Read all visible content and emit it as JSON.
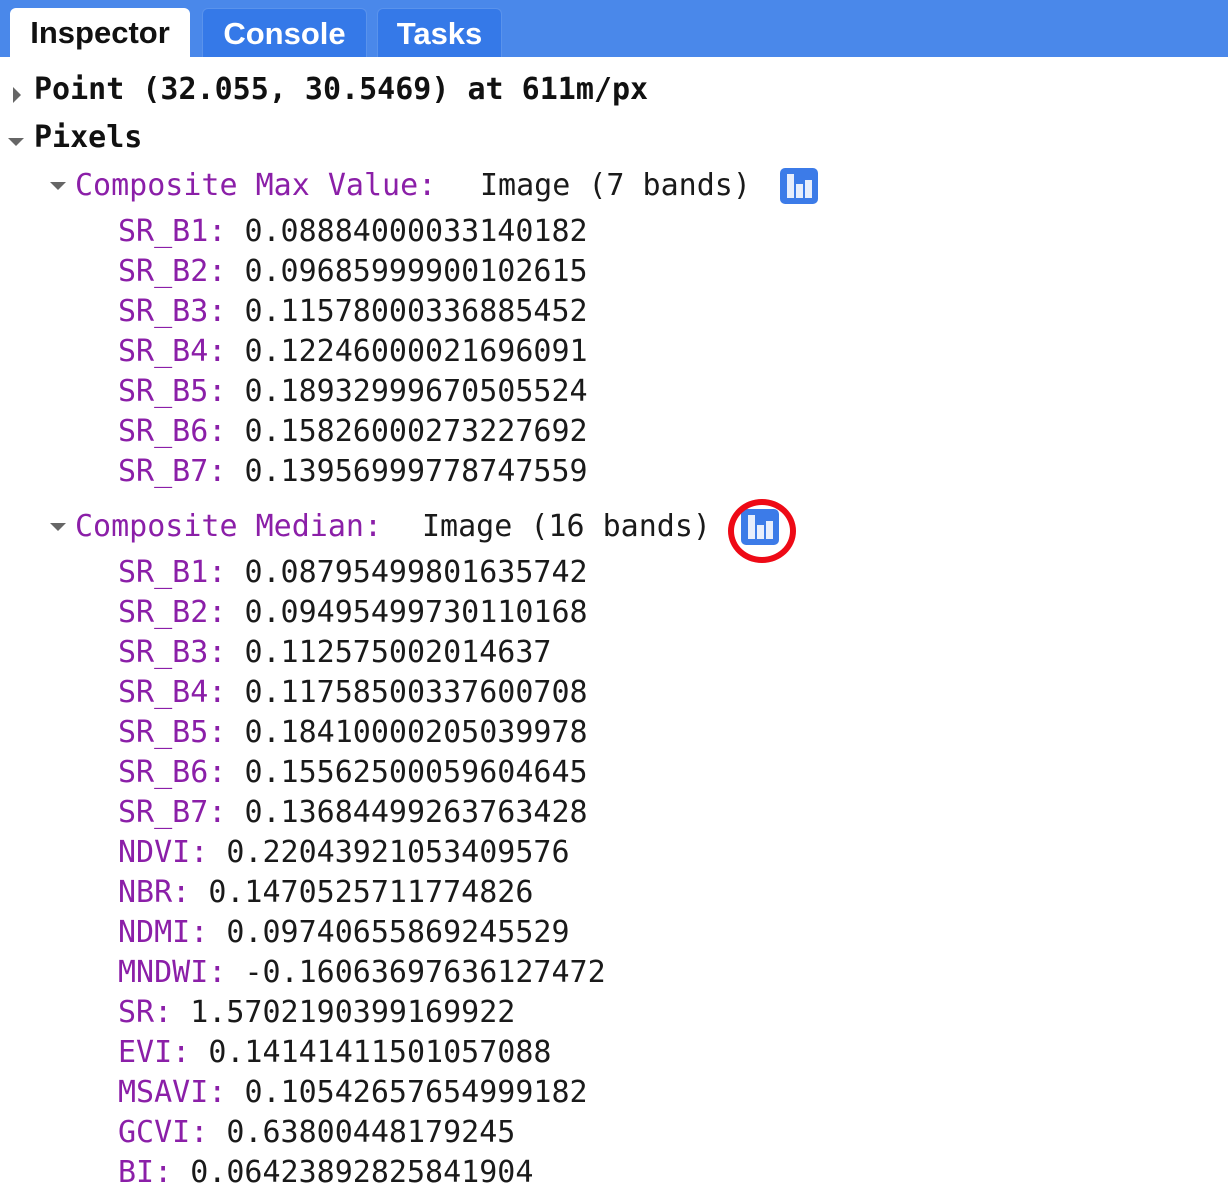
{
  "tabs": [
    {
      "label": "Inspector",
      "active": true
    },
    {
      "label": "Console",
      "active": false
    },
    {
      "label": "Tasks",
      "active": false
    }
  ],
  "point": {
    "label": "Point (32.055, 30.5469) at 611m/px",
    "expanded": false
  },
  "pixels": {
    "label": "Pixels",
    "expanded": true,
    "groups": [
      {
        "name": "Composite Max Value:",
        "summary": "Image (7 bands)",
        "chart_icon": "bar-chart-icon",
        "highlighted": false,
        "bands": [
          {
            "key": "SR_B1:",
            "value": "0.0888400003314018​2"
          },
          {
            "key": "SR_B2:",
            "value": "0.09685999900102615"
          },
          {
            "key": "SR_B3:",
            "value": "0.11578000336885452"
          },
          {
            "key": "SR_B4:",
            "value": "0.12246000021696091"
          },
          {
            "key": "SR_B5:",
            "value": "0.18932999670505524"
          },
          {
            "key": "SR_B6:",
            "value": "0.15826000273227692"
          },
          {
            "key": "SR_B7:",
            "value": "0.13956999778747559"
          }
        ]
      },
      {
        "name": "Composite Median:",
        "summary": "Image (16 bands)",
        "chart_icon": "bar-chart-icon",
        "highlighted": true,
        "bands": [
          {
            "key": "SR_B1:",
            "value": "0.08795499801635742"
          },
          {
            "key": "SR_B2:",
            "value": "0.09495499730110168"
          },
          {
            "key": "SR_B3:",
            "value": "0.112575002014637"
          },
          {
            "key": "SR_B4:",
            "value": "0.11758500337600708"
          },
          {
            "key": "SR_B5:",
            "value": "0.18410000205039978"
          },
          {
            "key": "SR_B6:",
            "value": "0.15562500059604645"
          },
          {
            "key": "SR_B7:",
            "value": "0.13684499263763428"
          },
          {
            "key": "NDVI:",
            "value": "0.22043921053409576"
          },
          {
            "key": "NBR:",
            "value": "0.1470525711774826"
          },
          {
            "key": "NDMI:",
            "value": "0.09740655869245529"
          },
          {
            "key": "MNDWI:",
            "value": "-0.16063697636127472"
          },
          {
            "key": "SR:",
            "value": "1.5702190399169922"
          },
          {
            "key": "EVI:",
            "value": "0.14141411501057088"
          },
          {
            "key": "MSAVI:",
            "value": "0.10542657654999182"
          },
          {
            "key": "GCVI:",
            "value": "0.63800448179245"
          },
          {
            "key": "BI:",
            "value": "0.06423892825841904"
          }
        ]
      }
    ]
  },
  "colors": {
    "tabbar": "#4a88ea",
    "inactive_tab": "#3579e8",
    "key_purple": "#8b1fa8",
    "chart_button": "#3c7be8",
    "highlight_ring": "#ee0a16"
  }
}
